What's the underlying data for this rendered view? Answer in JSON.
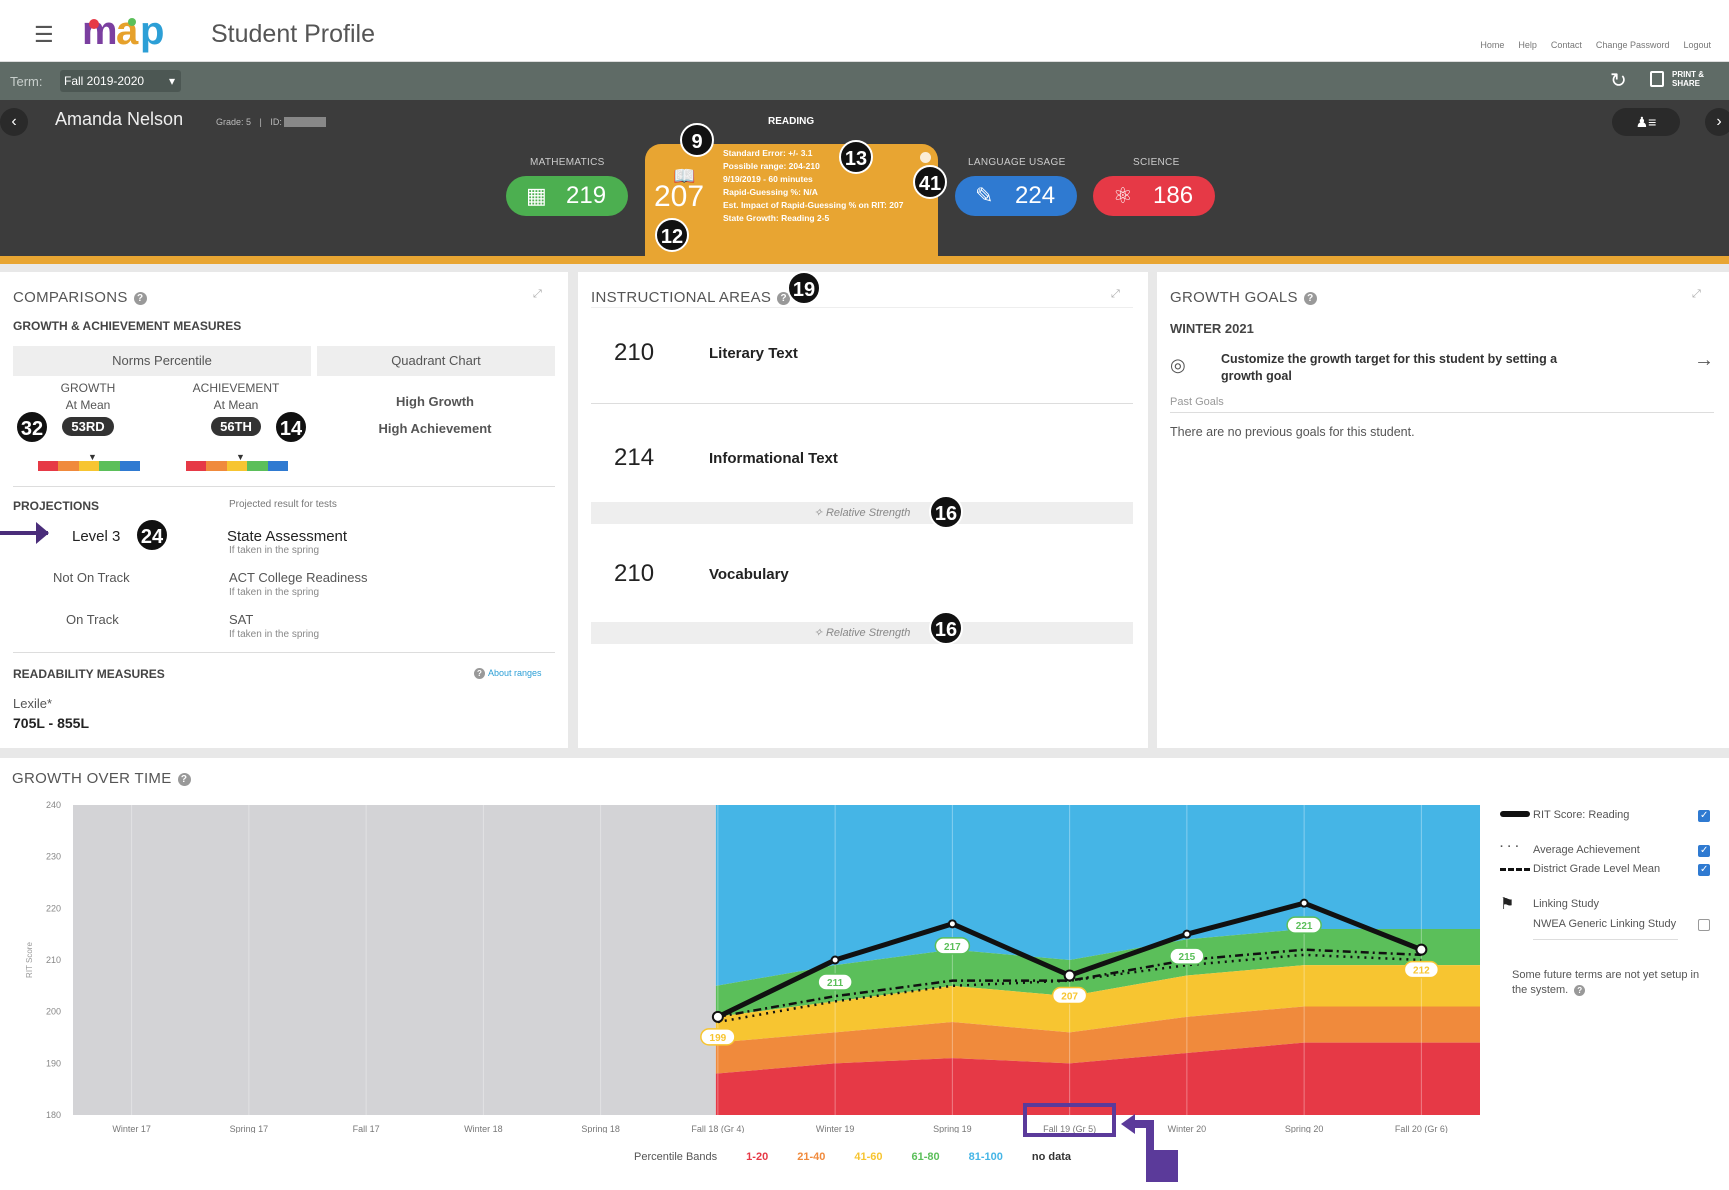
{
  "header": {
    "app_title": "Student Profile",
    "nav_links": [
      "Home",
      "Help",
      "Contact",
      "Change Password",
      "Logout"
    ]
  },
  "termbar": {
    "term_label": "Term:",
    "term_value": "Fall 2019-2020",
    "print_share": "PRINT & SHARE"
  },
  "student": {
    "name": "Amanda Nelson",
    "grade": "Grade: 5",
    "id_label": "ID:",
    "id_value": "XXXXXX"
  },
  "subjects": {
    "math": {
      "label": "MATHEMATICS",
      "score": "219",
      "color": "#4caf50"
    },
    "reading": {
      "label": "READING",
      "score": "207",
      "color": "#e8a532",
      "details": [
        "Standard Error: +/- 3.1",
        "Possible range: 204-210",
        "9/19/2019 - 60 minutes",
        "Rapid-Guessing %: N/A",
        "Est. Impact of Rapid-Guessing % on RIT: 207",
        "State Growth: Reading 2-5"
      ]
    },
    "language": {
      "label": "LANGUAGE USAGE",
      "score": "224",
      "color": "#2f7ad1"
    },
    "science": {
      "label": "SCIENCE",
      "score": "186",
      "color": "#e63946"
    }
  },
  "badges": [
    "9",
    "13",
    "41",
    "12",
    "19",
    "32",
    "14",
    "24",
    "16",
    "16"
  ],
  "comparisons": {
    "title": "COMPARISONS",
    "subtitle": "GROWTH & ACHIEVEMENT MEASURES",
    "tab_norms": "Norms Percentile",
    "tab_quadrant": "Quadrant Chart",
    "growth_label": "GROWTH",
    "growth_sub": "At Mean",
    "growth_value": "53RD",
    "achievement_label": "ACHIEVEMENT",
    "achievement_sub": "At Mean",
    "achievement_value": "56TH",
    "quadrant_line1": "High Growth",
    "quadrant_line2": "High Achievement",
    "projections_title": "PROJECTIONS",
    "projected_header": "Projected result for tests",
    "projections": [
      {
        "result": "Level 3",
        "test": "State Assessment",
        "note": "If taken in the spring"
      },
      {
        "result": "Not On Track",
        "test": "ACT College Readiness",
        "note": "If taken in the spring"
      },
      {
        "result": "On Track",
        "test": "SAT",
        "note": "If taken in the spring"
      }
    ],
    "readability_title": "READABILITY MEASURES",
    "about_ranges": "About ranges",
    "lexile_label": "Lexile*",
    "lexile_value": "705L - 855L"
  },
  "instructional": {
    "title": "INSTRUCTIONAL AREAS",
    "areas": [
      {
        "score": "210",
        "name": "Literary Text",
        "note": ""
      },
      {
        "score": "214",
        "name": "Informational Text",
        "note": "Relative Strength"
      },
      {
        "score": "210",
        "name": "Vocabulary",
        "note": "Relative Strength"
      }
    ]
  },
  "goals": {
    "title": "GROWTH GOALS",
    "term": "WINTER 2021",
    "cta": "Customize the growth target for this student by setting a growth goal",
    "past_label": "Past Goals",
    "past_empty": "There are no previous goals for this student."
  },
  "growth": {
    "title": "GROWTH OVER TIME",
    "ylabel": "RIT Score",
    "legend": {
      "rit": "RIT Score: Reading",
      "avg": "Average Achievement",
      "district": "District Grade Level Mean",
      "linking": "Linking Study",
      "nwea": "NWEA Generic Linking Study",
      "note": "Some future terms are not yet setup in the system."
    },
    "bands_label": "Percentile Bands",
    "bands": [
      {
        "label": "1-20",
        "color": "#e63946"
      },
      {
        "label": "21-40",
        "color": "#f08a3c"
      },
      {
        "label": "41-60",
        "color": "#f7c531"
      },
      {
        "label": "61-80",
        "color": "#5bbf5a"
      },
      {
        "label": "81-100",
        "color": "#45b5e6"
      },
      {
        "label": "no data",
        "color": "#333333"
      }
    ]
  },
  "chart_data": {
    "type": "line",
    "x": [
      "Winter 17",
      "Spring 17",
      "Fall 17",
      "Winter 18",
      "Spring 18",
      "Fall 18 (Gr 4)",
      "Winter 19",
      "Spring 19",
      "Fall 19 (Gr 5)",
      "Winter 20",
      "Spring 20",
      "Fall 20 (Gr 6)"
    ],
    "ylim": [
      180,
      240
    ],
    "yticks": [
      180,
      190,
      200,
      210,
      220,
      230,
      240
    ],
    "ylabel": "RIT Score",
    "series": [
      {
        "name": "RIT Score: Reading",
        "x_index": [
          5,
          6,
          7,
          8,
          9,
          10,
          11
        ],
        "values": [
          199,
          210,
          217,
          207,
          215,
          221,
          212
        ],
        "labels": [
          "199",
          "211",
          "217",
          "207",
          "215",
          "221",
          "212"
        ]
      },
      {
        "name": "Average Achievement",
        "x_index": [
          5,
          6,
          7,
          8,
          9,
          10,
          11
        ],
        "values": [
          198,
          202,
          205,
          206,
          209,
          211,
          210
        ]
      },
      {
        "name": "District Grade Level Mean",
        "x_index": [
          5,
          6,
          7,
          8,
          9,
          10,
          11
        ],
        "values": [
          199,
          203,
          206,
          206,
          210,
          212,
          211
        ]
      }
    ],
    "bands": {
      "x_index": [
        5,
        6,
        7,
        8,
        9,
        10,
        11
      ],
      "b20": [
        188,
        190,
        191,
        190,
        192,
        194,
        194
      ],
      "b40": [
        194,
        196,
        198,
        196,
        199,
        201,
        201
      ],
      "b60": [
        199,
        202,
        205,
        203,
        207,
        209,
        209
      ],
      "b80": [
        205,
        209,
        212,
        210,
        214,
        216,
        216
      ]
    },
    "no_data_range": [
      0,
      5
    ],
    "grid": true
  }
}
